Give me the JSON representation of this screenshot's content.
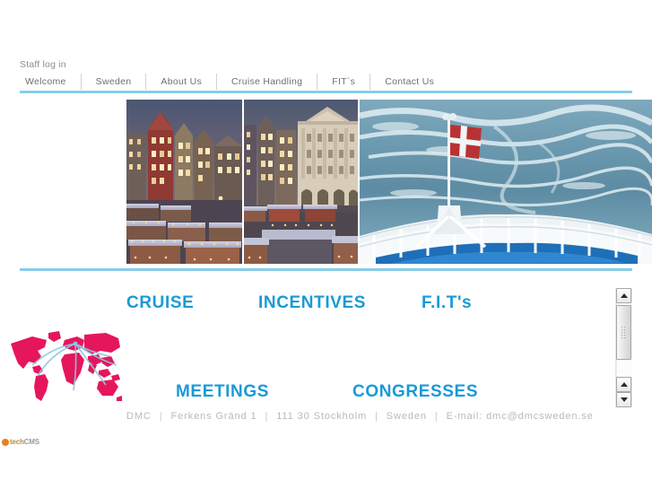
{
  "site": {
    "title": "DMC Sweden",
    "accent_blue": "#1a9ad7",
    "rule_blue": "#87cdea",
    "nav_text_color": "#6f6f6f",
    "footer_text_color": "#b9b9b9"
  },
  "utility": {
    "staff_login": "Staff log in"
  },
  "nav": {
    "items": [
      {
        "label": "Welcome"
      },
      {
        "label": "Sweden"
      },
      {
        "label": "About Us"
      },
      {
        "label": "Cruise Handling"
      },
      {
        "label": "FIT`s"
      },
      {
        "label": "Contact Us"
      }
    ]
  },
  "banner": {
    "images": [
      {
        "name": "stockholm-christmas-market-left",
        "alt": "Stockholm Gamla Stan Christmas market at dusk"
      },
      {
        "name": "stockholm-christmas-market-right",
        "alt": "Stortorget square with Nobel Museum and market stalls"
      },
      {
        "name": "ferry-stern-danish-flag",
        "alt": "Ship stern with Danish flag over sea wake"
      }
    ]
  },
  "services": {
    "headings": [
      {
        "label": "CRUISE"
      },
      {
        "label": "INCENTIVES"
      },
      {
        "label": "F.I.T's"
      },
      {
        "label": "MEETINGS"
      },
      {
        "label": "CONGRESSES"
      }
    ]
  },
  "world_map": {
    "name": "world-map-routes",
    "land_color": "#e6165c",
    "route_color": "#8fc6e0"
  },
  "footer": {
    "company": "DMC",
    "street": "Ferkens Gränd 1",
    "postal_city": "111 30 Stockholm",
    "country": "Sweden",
    "email_label": "E-mail:",
    "email": "dmc@dmcsweden.se",
    "separator": "|"
  },
  "cms_badge": {
    "part_one": "tech",
    "part_two": "CMS"
  },
  "scrollbar": {
    "orientation": "vertical",
    "up_arrow": "▲",
    "down_arrow": "▼"
  }
}
